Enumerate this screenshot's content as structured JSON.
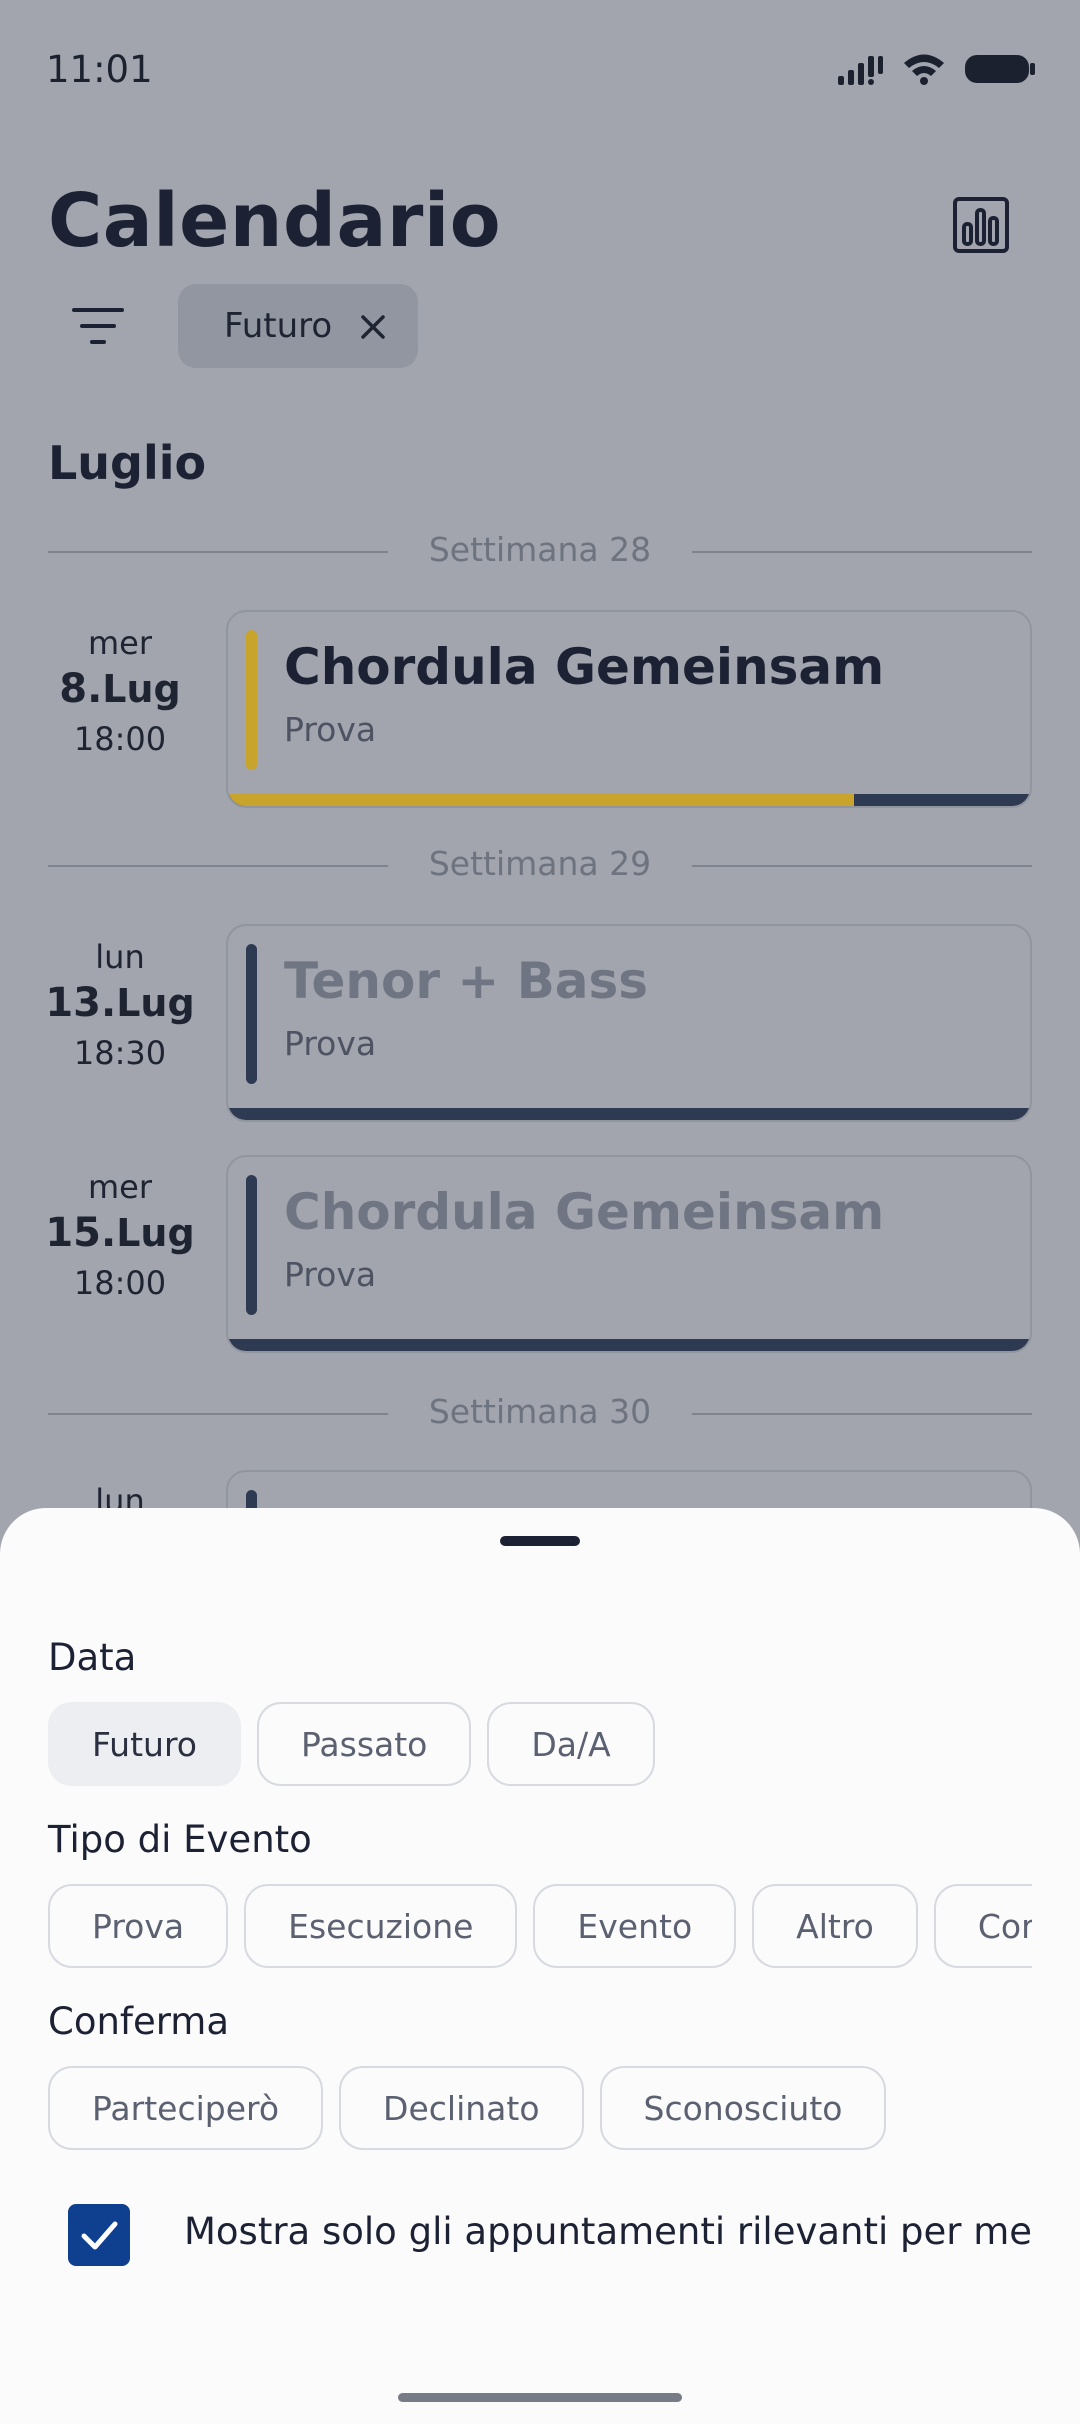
{
  "status_bar": {
    "time": "11:01"
  },
  "header": {
    "title": "Calendario",
    "stats_icon": "bar-chart-icon"
  },
  "active_filter": {
    "label": "Futuro"
  },
  "month": "Luglio",
  "weeks": [
    "Settimana 28",
    "Settimana 29",
    "Settimana 30"
  ],
  "events": [
    {
      "dow": "mer",
      "day": "8.",
      "month": "Lug",
      "time": "18:00",
      "title": "Chordula Gemeinsam",
      "type": "Prova",
      "stripe_color": "#c8a42c",
      "title_color": "#1c2233",
      "progress": 0.78
    },
    {
      "dow": "lun",
      "day": "13.",
      "month": "Lug",
      "time": "18:30",
      "title": "Tenor + Bass",
      "type": "Prova",
      "stripe_color": "#2d3a52",
      "title_color": "#6f7582",
      "progress": 0
    },
    {
      "dow": "mer",
      "day": "15.",
      "month": "Lug",
      "time": "18:00",
      "title": "Chordula Gemeinsam",
      "type": "Prova",
      "stripe_color": "#2d3a52",
      "title_color": "#6f7582",
      "progress": 0
    },
    {
      "dow": "lun",
      "day": "",
      "month": "",
      "time": "",
      "title": "",
      "type": "",
      "stripe_color": "#2d3a52",
      "title_color": "#6f7582",
      "progress": 0
    }
  ],
  "sheet": {
    "date_title": "Data",
    "date_options": [
      "Futuro",
      "Passato",
      "Da/A"
    ],
    "date_selected": "Futuro",
    "event_type_title": "Tipo di Evento",
    "event_type_options": [
      "Prova",
      "Esecuzione",
      "Evento",
      "Altro",
      "Com"
    ],
    "confirm_title": "Conferma",
    "confirm_options": [
      "Parteciperò",
      "Declinato",
      "Sconosciuto"
    ],
    "only_relevant_label": "Mostra solo gli appuntamenti rilevanti per me",
    "only_relevant_checked": true
  }
}
